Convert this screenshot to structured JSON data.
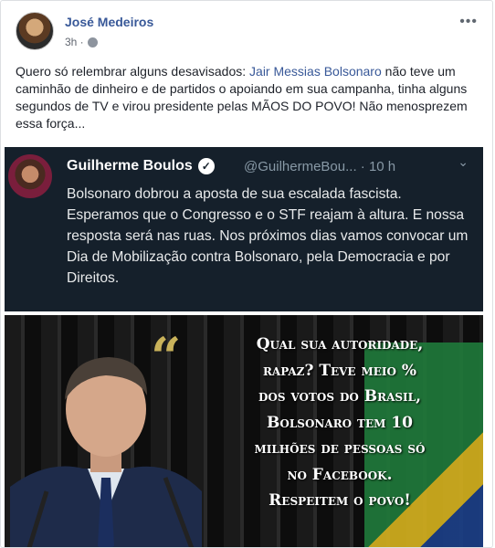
{
  "post": {
    "author": "José Medeiros",
    "time": "3h ·",
    "text_before": "Quero só relembrar alguns desavisados: ",
    "mention": "Jair Messias Bolsonaro",
    "text_after": " não teve um caminhão de dinheiro e de partidos o apoiando em sua campanha, tinha alguns segundos de TV e virou presidente pelas MÃOS DO POVO! Não menosprezem essa força..."
  },
  "tweet": {
    "name": "Guilherme Boulos",
    "handle": "@GuilhermeBou... · 10 h",
    "body": "Bolsonaro dobrou a aposta de sua escalada fascista. Esperamos que o Congresso e o STF reajam à altura. E nossa resposta será nas ruas. Nos próximos dias vamos convocar um Dia de Mobilização contra Bolsonaro, pela Democracia e por Direitos."
  },
  "image": {
    "quote_mark": "“",
    "lines": [
      "Qual sua autoridade,",
      "rapaz? Teve meio %",
      "dos votos do Brasil,",
      "Bolsonaro tem 10",
      "milhões de pessoas só",
      "no Facebook.",
      "Respeitem o povo!"
    ]
  },
  "icons": {
    "more": "more-options-icon",
    "globe": "globe-icon",
    "verified": "verified-badge-icon",
    "chevron": "chevron-down-icon"
  },
  "colors": {
    "link": "#385898",
    "tweet_bg": "#15202b",
    "quote": "#c9b25a"
  }
}
